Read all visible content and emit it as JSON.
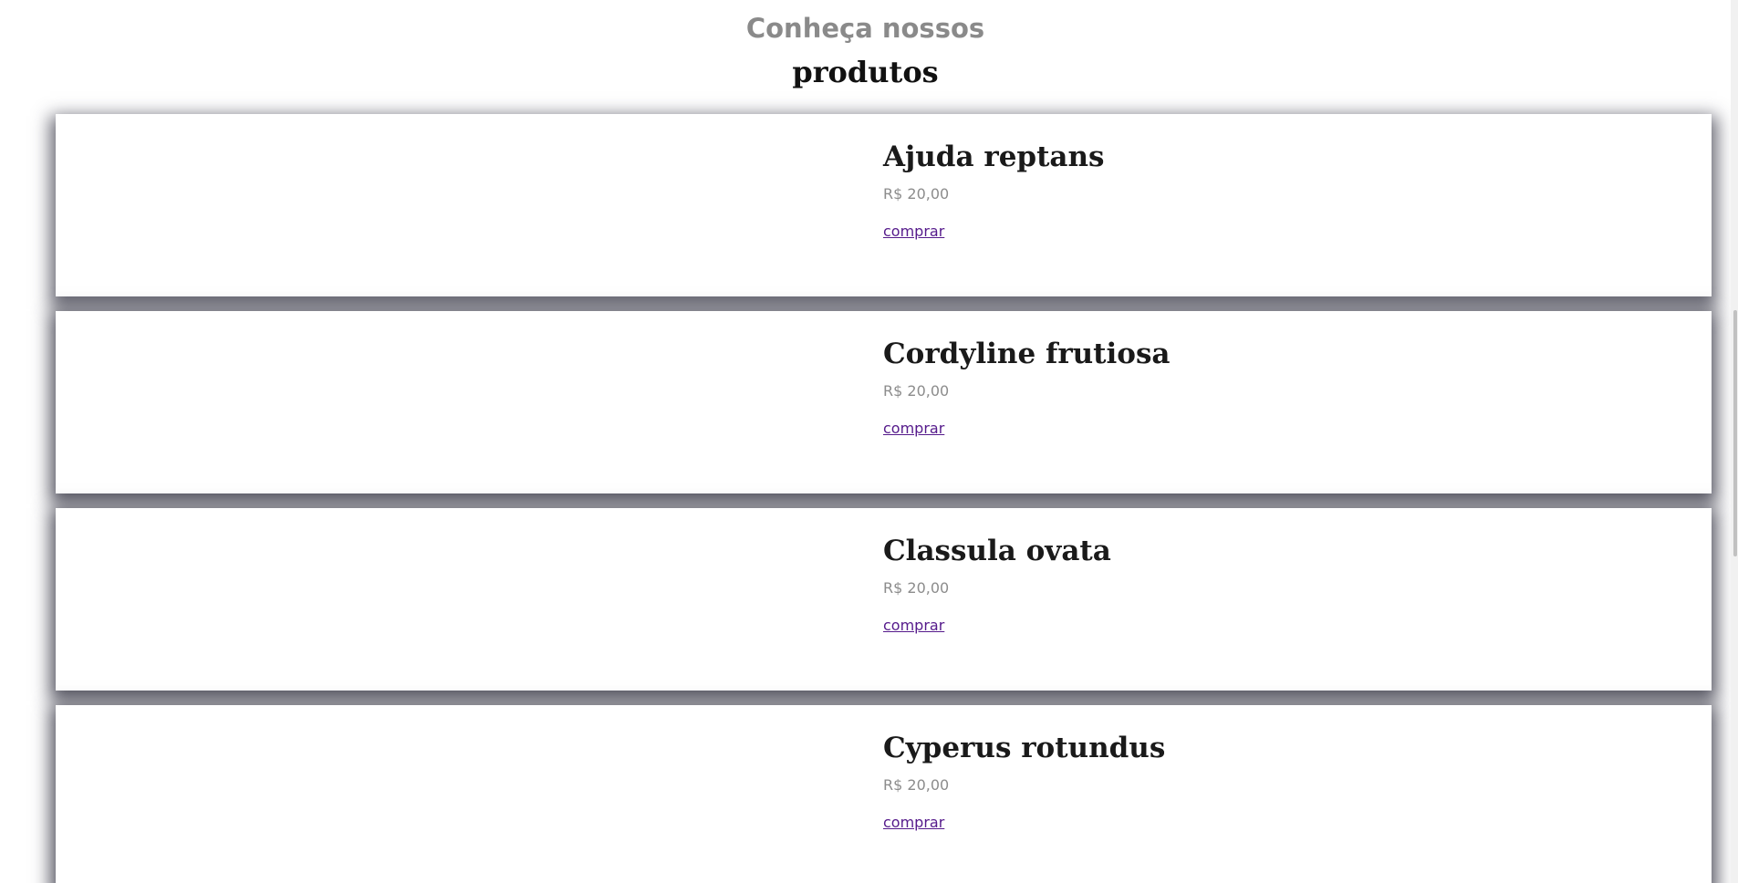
{
  "section": {
    "heading_line1": "Conheça nossos",
    "heading_line2": "produtos"
  },
  "products": [
    {
      "name": "Ajuda reptans",
      "price": "R$ 20,00",
      "buy_label": "comprar"
    },
    {
      "name": "Cordyline frutiosa",
      "price": "R$ 20,00",
      "buy_label": "comprar"
    },
    {
      "name": "Classula ovata",
      "price": "R$ 20,00",
      "buy_label": "comprar"
    },
    {
      "name": "Cyperus rotundus",
      "price": "R$ 20,00",
      "buy_label": "comprar"
    }
  ],
  "colors": {
    "heading_gray": "#8a8a8a",
    "title_dark": "#1a1a1a",
    "price_gray": "#8c8c8c",
    "link_visited": "#551a8b"
  }
}
